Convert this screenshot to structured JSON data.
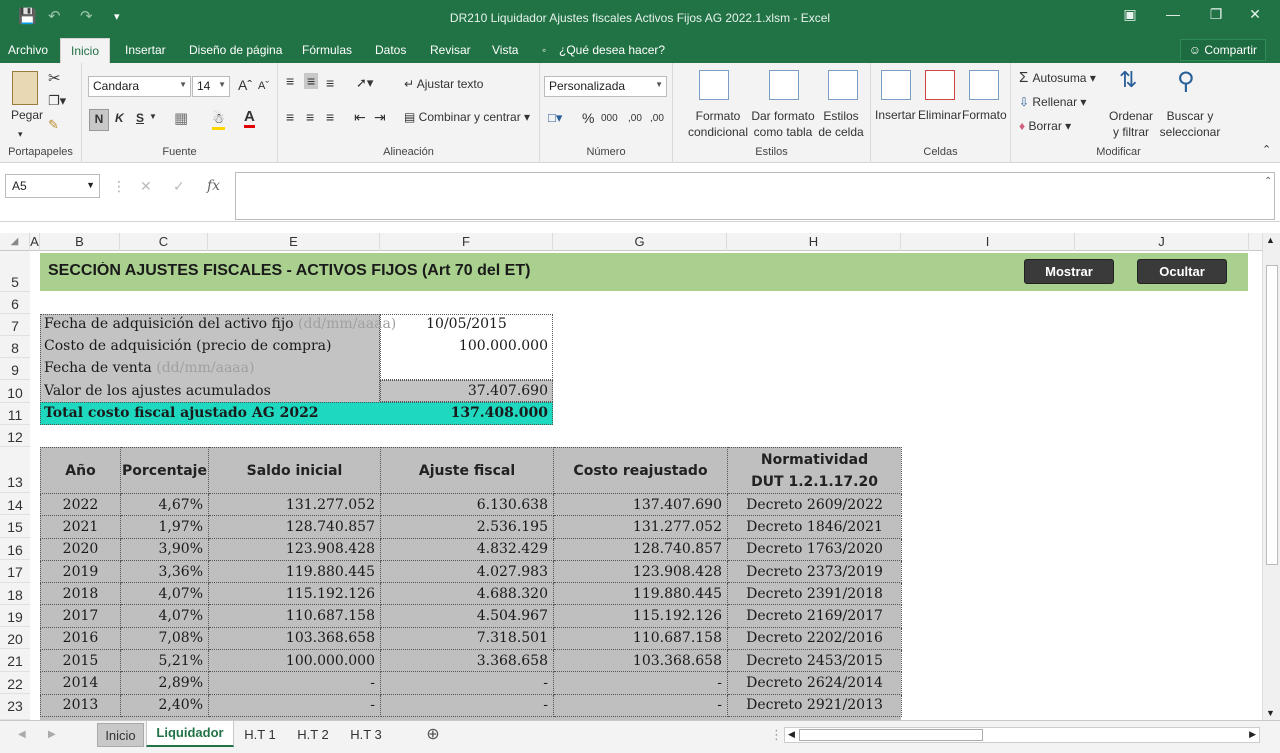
{
  "window": {
    "title": "DR210 Liquidador Ajustes fiscales Activos Fijos AG 2022.1.xlsm - Excel"
  },
  "tabs": [
    "Archivo",
    "Inicio",
    "Insertar",
    "Diseño de página",
    "Fórmulas",
    "Datos",
    "Revisar",
    "Vista",
    "¿Qué desea hacer?"
  ],
  "share_label": "Compartir",
  "ribbon": {
    "paste": "Pegar",
    "clipboard": "Portapapeles",
    "font_name": "Candara",
    "font_size": "14",
    "bold": "N",
    "italic": "K",
    "underline": "S",
    "font_group": "Fuente",
    "wrap": "Ajustar texto",
    "merge": "Combinar y centrar",
    "align_group": "Alineación",
    "number_format": "Personalizada",
    "percent": "%",
    "thousands": "000",
    "dec_up": ",00",
    "dec_down": ",00",
    "number_group": "Número",
    "cond_format": "Formato condicional",
    "format_table": "Dar formato como tabla",
    "cell_styles": "Estilos de celda",
    "styles_group": "Estilos",
    "insert": "Insertar",
    "delete": "Eliminar",
    "format": "Formato",
    "cells_group": "Celdas",
    "autosum": "Autosuma",
    "fill": "Rellenar",
    "clear": "Borrar",
    "sort": "Ordenar y filtrar",
    "find": "Buscar y seleccionar",
    "edit_group": "Modificar"
  },
  "formula_bar": {
    "name_box": "A5",
    "formula": ""
  },
  "columns": [
    "A",
    "B",
    "C",
    "E",
    "F",
    "G",
    "H",
    "I",
    "J"
  ],
  "rows": [
    "5",
    "6",
    "7",
    "8",
    "9",
    "10",
    "11",
    "12",
    "13",
    "14",
    "15",
    "16",
    "17",
    "18",
    "19",
    "20",
    "21",
    "22",
    "23"
  ],
  "sheet": {
    "header_title": "SECCIÓN AJUSTES FISCALES - ACTIVOS FIJOS (Art 70 del ET)",
    "btn_show": "Mostrar",
    "btn_hide": "Ocultar",
    "info": [
      {
        "label": "Fecha de adquisición del activo fijo",
        "hint": " (dd/mm/aaaa)",
        "value": "10/05/2015"
      },
      {
        "label": "Costo de adquisición (precio de compra)",
        "hint": "",
        "value": "100.000.000"
      },
      {
        "label": "Fecha de venta",
        "hint": " (dd/mm/aaaa)",
        "value": ""
      },
      {
        "label": "Valor de los ajustes acumulados",
        "hint": "",
        "value": "37.407.690"
      },
      {
        "label": "Total costo fiscal ajustado AG 2022",
        "hint": "",
        "value": "137.408.000"
      }
    ],
    "table_headers": [
      "Año",
      "Porcentaje",
      "Saldo inicial",
      "Ajuste fiscal",
      "Costo reajustado",
      "Normatividad",
      "DUT 1.2.1.17.20"
    ],
    "table_rows": [
      [
        "2022",
        "4,67%",
        "131.277.052",
        "6.130.638",
        "137.407.690",
        "Decreto 2609/2022"
      ],
      [
        "2021",
        "1,97%",
        "128.740.857",
        "2.536.195",
        "131.277.052",
        "Decreto 1846/2021"
      ],
      [
        "2020",
        "3,90%",
        "123.908.428",
        "4.832.429",
        "128.740.857",
        "Decreto 1763/2020"
      ],
      [
        "2019",
        "3,36%",
        "119.880.445",
        "4.027.983",
        "123.908.428",
        "Decreto 2373/2019"
      ],
      [
        "2018",
        "4,07%",
        "115.192.126",
        "4.688.320",
        "119.880.445",
        "Decreto 2391/2018"
      ],
      [
        "2017",
        "4,07%",
        "110.687.158",
        "4.504.967",
        "115.192.126",
        "Decreto 2169/2017"
      ],
      [
        "2016",
        "7,08%",
        "103.368.658",
        "7.318.501",
        "110.687.158",
        "Decreto 2202/2016"
      ],
      [
        "2015",
        "5,21%",
        "100.000.000",
        "3.368.658",
        "103.368.658",
        "Decreto 2453/2015"
      ],
      [
        "2014",
        "2,89%",
        "-",
        "-",
        "-",
        "Decreto 2624/2014"
      ],
      [
        "2013",
        "2,40%",
        "-",
        "-",
        "-",
        "Decreto 2921/2013"
      ]
    ]
  },
  "sheet_tabs": [
    "Inicio",
    "Liquidador",
    "H.T 1",
    "H.T 2",
    "H.T 3"
  ],
  "active_sheet": "Liquidador",
  "colors": {
    "excel_green": "#217346",
    "section_bg": "#a9d08e",
    "total_bg": "#1fd8c0",
    "table_bg": "#bfbfbf"
  }
}
